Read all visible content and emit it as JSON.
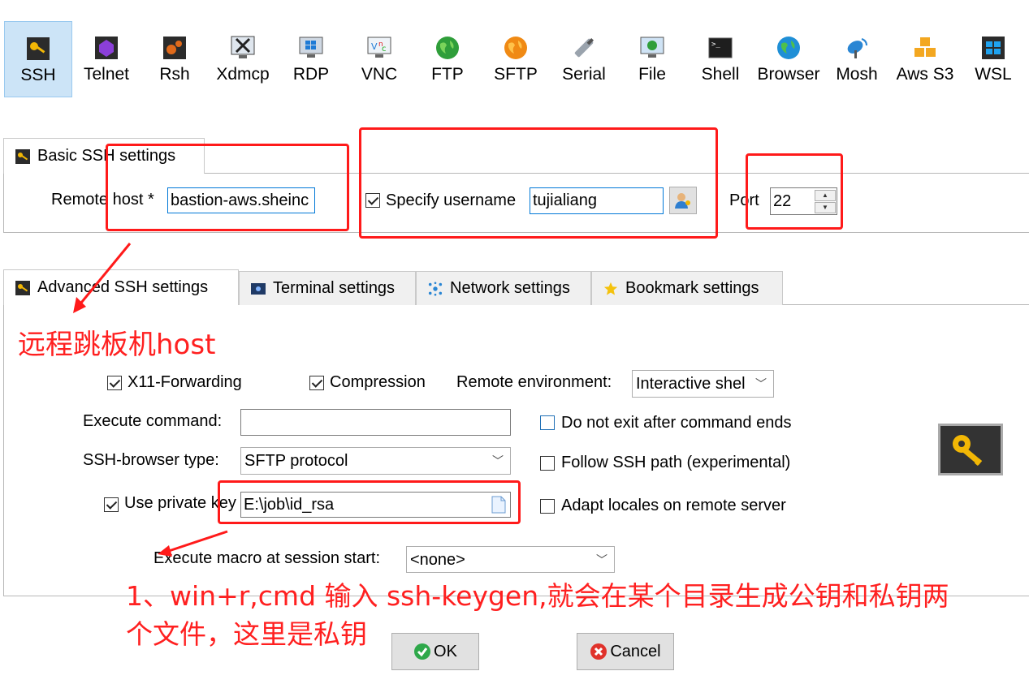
{
  "session_types": [
    {
      "label": "SSH",
      "icon": "ssh-key-icon",
      "selected": true
    },
    {
      "label": "Telnet",
      "icon": "telnet-icon"
    },
    {
      "label": "Rsh",
      "icon": "rsh-icon"
    },
    {
      "label": "Xdmcp",
      "icon": "xdmcp-icon"
    },
    {
      "label": "RDP",
      "icon": "rdp-icon"
    },
    {
      "label": "VNC",
      "icon": "vnc-icon"
    },
    {
      "label": "FTP",
      "icon": "ftp-globe-icon"
    },
    {
      "label": "SFTP",
      "icon": "sftp-globe-icon"
    },
    {
      "label": "Serial",
      "icon": "serial-plug-icon"
    },
    {
      "label": "File",
      "icon": "file-monitor-icon"
    },
    {
      "label": "Shell",
      "icon": "shell-terminal-icon"
    },
    {
      "label": "Browser",
      "icon": "browser-globe-icon"
    },
    {
      "label": "Mosh",
      "icon": "mosh-satellite-icon"
    },
    {
      "label": "Aws S3",
      "icon": "aws-s3-cubes-icon"
    },
    {
      "label": "WSL",
      "icon": "wsl-windows-icon"
    }
  ],
  "basic": {
    "tab_label": "Basic SSH settings",
    "remote_host_label": "Remote host *",
    "remote_host_value": "bastion-aws.sheinc",
    "specify_username_label": "Specify username",
    "specify_username_checked": true,
    "username_value": "tujialiang",
    "port_label": "Port",
    "port_value": "22"
  },
  "tabs": {
    "advanced": "Advanced SSH settings",
    "terminal": "Terminal settings",
    "network": "Network settings",
    "bookmark": "Bookmark settings"
  },
  "advanced": {
    "x11_label": "X11-Forwarding",
    "x11_checked": true,
    "compression_label": "Compression",
    "compression_checked": true,
    "remote_env_label": "Remote environment:",
    "remote_env_value": "Interactive shel",
    "exec_cmd_label": "Execute command:",
    "exec_cmd_value": "",
    "no_exit_label": "Do not exit after command ends",
    "ssh_browser_label": "SSH-browser type:",
    "ssh_browser_value": "SFTP protocol",
    "follow_path_label": "Follow SSH path (experimental)",
    "private_key_label": "Use private key",
    "private_key_checked": true,
    "private_key_value": "E:\\job\\id_rsa",
    "adapt_locales_label": "Adapt locales on remote server",
    "macro_label": "Execute macro at session start:",
    "macro_value": "<none>"
  },
  "buttons": {
    "ok": "OK",
    "cancel": "Cancel"
  },
  "annotations": {
    "remote_host_note": "远程跳板机host",
    "key_note_line1": "1、win+r,cmd 输入 ssh-keygen,就会在某个目录生成公钥和私钥两",
    "key_note_line2": "个文件，这里是私钥"
  },
  "colors": {
    "selected_bg": "#cce4f7",
    "annotation_red": "#ff1a1a",
    "ok_green": "#2ea84a",
    "cancel_red": "#e0322b"
  }
}
